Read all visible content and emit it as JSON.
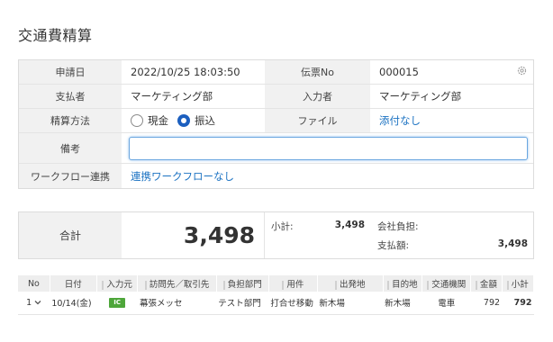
{
  "page": {
    "title": "交通費精算"
  },
  "form": {
    "apply_date": {
      "label": "申請日",
      "value": "2022/10/25 18:03:50"
    },
    "voucher_no": {
      "label": "伝票No",
      "value": "000015"
    },
    "payer": {
      "label": "支払者",
      "value": "マーケティング部"
    },
    "entered_by": {
      "label": "入力者",
      "value": "マーケティング部"
    },
    "settlement": {
      "label": "精算方法",
      "options": [
        "現金",
        "振込"
      ],
      "selected": "振込"
    },
    "file": {
      "label": "ファイル",
      "value": "添付なし"
    },
    "memo": {
      "label": "備考",
      "value": ""
    },
    "workflow": {
      "label": "ワークフロー連携",
      "value": "連携ワークフローなし"
    }
  },
  "totals": {
    "label": "合計",
    "total": "3,498",
    "subtotal_label": "小計:",
    "subtotal": "3,498",
    "company_label": "会社負担:",
    "payment_label": "支払額:",
    "payment": "3,498"
  },
  "detail": {
    "headers": [
      "No",
      "日付",
      "入力元",
      "訪問先／取引先",
      "負担部門",
      "用件",
      "出発地",
      "目的地",
      "交通機関",
      "金額",
      "小計"
    ],
    "rows": [
      {
        "no": "1",
        "date": "10/14(金)",
        "source": "IC",
        "visit": "幕張メッセ",
        "dept": "テスト部門",
        "purpose": "打合せ移動",
        "from": "新木場",
        "to": "新木場",
        "transport": "電車",
        "amount": "792",
        "subtotal": "792"
      }
    ]
  },
  "icons": {
    "settings": "gear-icon",
    "row_menu": "chevron-down-icon",
    "ic_source": "ic-card-icon"
  },
  "colors": {
    "link": "#1b72c2",
    "radio_selected": "#1c5fbf",
    "ic_badge": "#4ea63a",
    "focus": "#6aa6e0"
  }
}
